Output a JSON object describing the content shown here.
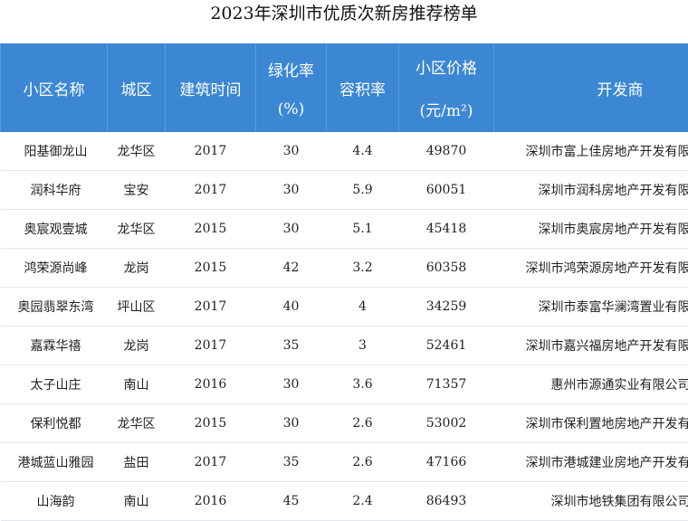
{
  "title": "2023年深圳市优质次新房推荐榜单",
  "table": {
    "headers": {
      "name": "小区名称",
      "district": "城区",
      "built": "建筑时间",
      "green_line1": "绿化率",
      "green_line2": "(%)",
      "far": "容积率",
      "price_line1": "小区价格",
      "price_line2": "(元/m²)",
      "developer": "开发商"
    },
    "rows": [
      {
        "name": "阳基御龙山",
        "district": "龙华区",
        "built": "2017",
        "green": "30",
        "far": "4.4",
        "price": "49870",
        "developer": "深圳市富上佳房地产开发有限"
      },
      {
        "name": "润科华府",
        "district": "宝安",
        "built": "2017",
        "green": "30",
        "far": "5.9",
        "price": "60051",
        "developer": "深圳市润科房地产开发有限"
      },
      {
        "name": "奥宸观壹城",
        "district": "龙华区",
        "built": "2015",
        "green": "30",
        "far": "5.1",
        "price": "45418",
        "developer": "深圳市奥宸房地产开发有限"
      },
      {
        "name": "鸿荣源尚峰",
        "district": "龙岗",
        "built": "2015",
        "green": "42",
        "far": "3.2",
        "price": "60358",
        "developer": "深圳市鸿荣源房地产开发有限"
      },
      {
        "name": "奥园翡翠东湾",
        "district": "坪山区",
        "built": "2017",
        "green": "40",
        "far": "4",
        "price": "34259",
        "developer": "深圳市泰富华澜湾置业有限"
      },
      {
        "name": "嘉霖华禧",
        "district": "龙岗",
        "built": "2017",
        "green": "35",
        "far": "3",
        "price": "52461",
        "developer": "深圳市嘉兴福房地产开发有限"
      },
      {
        "name": "太子山庄",
        "district": "南山",
        "built": "2016",
        "green": "30",
        "far": "3.6",
        "price": "71357",
        "developer": "惠州市源通实业有限公司"
      },
      {
        "name": "保利悦都",
        "district": "龙华区",
        "built": "2015",
        "green": "30",
        "far": "2.6",
        "price": "53002",
        "developer": "深圳市保利置地房地产开发有"
      },
      {
        "name": "港城蓝山雅园",
        "district": "盐田",
        "built": "2017",
        "green": "35",
        "far": "2.6",
        "price": "47166",
        "developer": "深圳市港城建业房地产开发有"
      },
      {
        "name": "山海韵",
        "district": "南山",
        "built": "2016",
        "green": "45",
        "far": "2.4",
        "price": "86493",
        "developer": "深圳市地铁集团有限公司"
      }
    ]
  },
  "colors": {
    "header_bg": "#3b87d3",
    "header_text": "#ffffff",
    "row_divider": "#e3e8ee"
  }
}
